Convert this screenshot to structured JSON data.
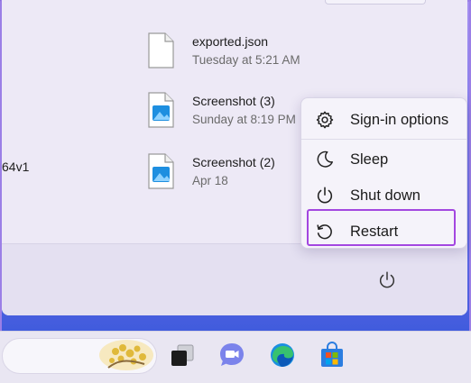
{
  "files": [
    {
      "name": "exported.json",
      "date": "Tuesday at 5:21 AM",
      "icon": "document-icon"
    },
    {
      "name": "Screenshot (3)",
      "date": "Sunday at 8:19 PM",
      "icon": "image-file-icon"
    },
    {
      "name": "Screenshot (2)",
      "date": "Apr 18",
      "icon": "image-file-icon"
    }
  ],
  "left_fragment": "64v1",
  "power_menu": {
    "items": [
      {
        "label": "Sign-in options",
        "icon": "gear-icon"
      },
      {
        "label": "Sleep",
        "icon": "moon-icon"
      },
      {
        "label": "Shut down",
        "icon": "power-icon"
      },
      {
        "label": "Restart",
        "icon": "restart-icon"
      }
    ],
    "highlight_color": "#a347e0"
  },
  "taskbar": {
    "icons": [
      "search-widget-icon",
      "task-view-icon",
      "teams-chat-icon",
      "edge-icon",
      "store-icon"
    ]
  },
  "colors": {
    "accent": "#a347e0",
    "menu_bg": "#ede9f6",
    "wallpaper": "#4f5fe0"
  }
}
